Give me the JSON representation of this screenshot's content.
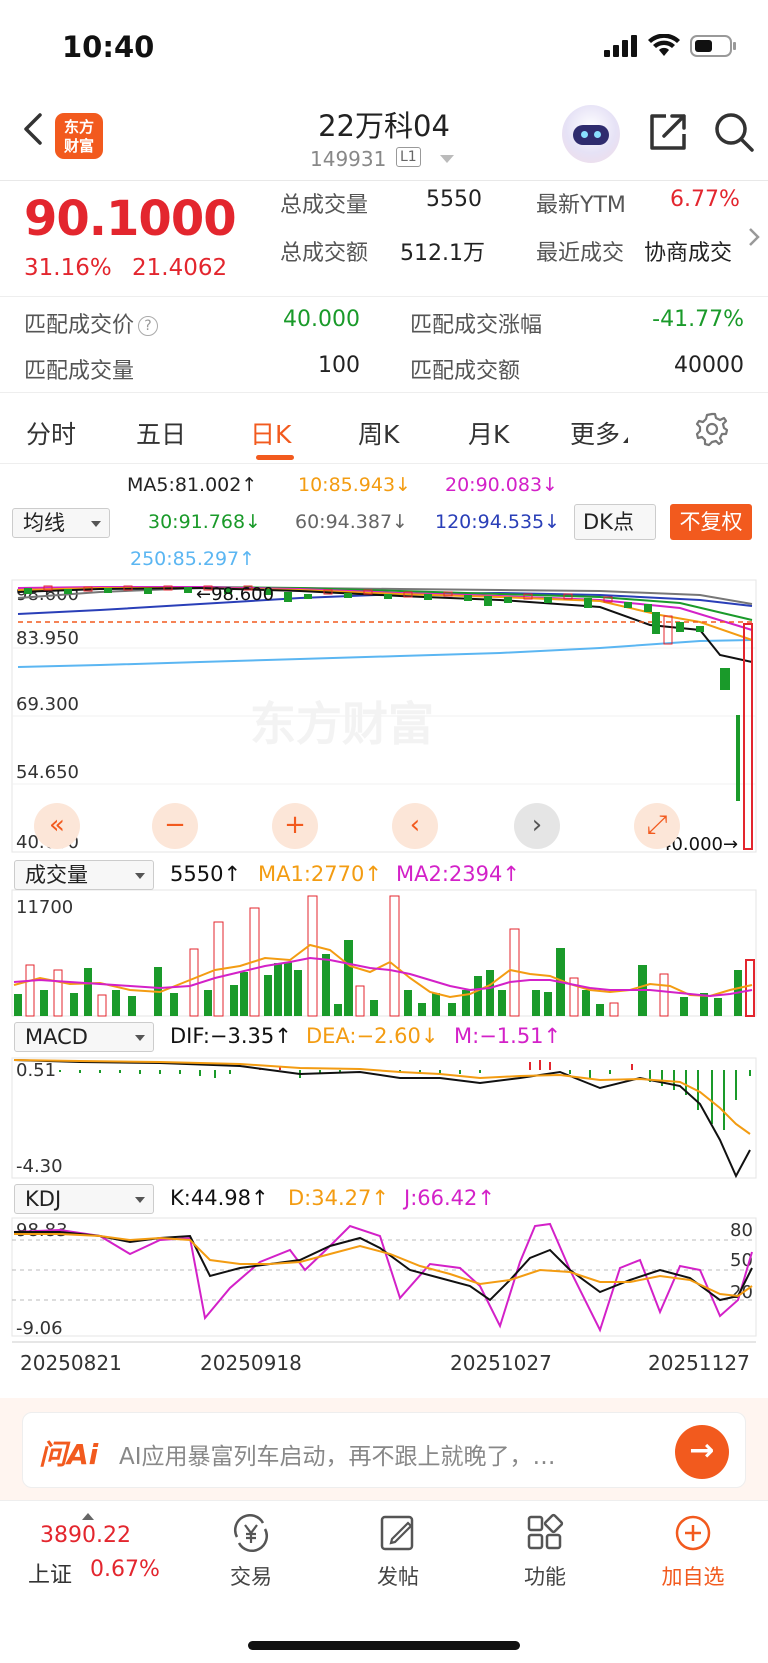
{
  "status_bar": {
    "time": "10:40"
  },
  "header": {
    "logo_line1": "东方",
    "logo_line2": "财富",
    "stock_name": "22万科04",
    "stock_code": "149931",
    "market_badge": "L1"
  },
  "quote": {
    "price": "90.1000",
    "change_pct": "31.16%",
    "change_amt": "21.4062",
    "total_volume_label": "总成交量",
    "total_volume": "5550",
    "total_amount_label": "总成交额",
    "total_amount": "512.1万",
    "ytm_label": "最新YTM",
    "ytm": "6.77%",
    "recent_trade_label": "最近成交",
    "recent_trade": "协商成交"
  },
  "match": {
    "price_label": "匹配成交价",
    "price": "40.000",
    "change_label": "匹配成交涨幅",
    "change": "-41.77%",
    "volume_label": "匹配成交量",
    "volume": "100",
    "amount_label": "匹配成交额",
    "amount": "40000"
  },
  "tabs": [
    "分时",
    "五日",
    "日K",
    "周K",
    "月K",
    "更多"
  ],
  "active_tab": "日K",
  "ma": {
    "selector": "均线",
    "ma5": "MA5:81.002↑",
    "ma10": "10:85.943↓",
    "ma20": "20:90.083↓",
    "ma30": "30:91.768↓",
    "ma60": "60:94.387↓",
    "ma120": "120:94.535↓",
    "ma250": "250:85.297↑",
    "dk_label": "DK点",
    "fuquan_label": "不复权"
  },
  "price_chart": {
    "y_labels": [
      "98.600",
      "83.950",
      "69.300",
      "54.650",
      "40.000"
    ],
    "max_marker": "98.600",
    "last_marker": "40.000",
    "watermark": "东方财富"
  },
  "volume_panel": {
    "selector": "成交量",
    "value": "5550↑",
    "ma1": "MA1:2770↑",
    "ma2": "MA2:2394↑",
    "y_max": "11700"
  },
  "macd_panel": {
    "selector": "MACD",
    "dif": "DIF:−3.35↑",
    "dea": "DEA:−2.60↓",
    "m": "M:−1.51↑",
    "y_max": "0.51",
    "y_min": "-4.30"
  },
  "kdj_panel": {
    "selector": "KDJ",
    "k": "K:44.98↑",
    "d": "D:34.27↑",
    "j": "J:66.42↑",
    "y_max": "98.83",
    "y_min": "-9.06",
    "levels": [
      "80",
      "50",
      "20"
    ]
  },
  "x_dates": [
    "20250821",
    "20250918",
    "20251027",
    "20251127"
  ],
  "ai": {
    "logo": "问Ai",
    "text": "AI应用暴富列车启动，再不跟上就晚了，…"
  },
  "bottom_nav": {
    "index_value": "3890.22",
    "index_name": "上证",
    "index_pct": "0.67%",
    "items": [
      "交易",
      "发帖",
      "功能",
      "加自选"
    ]
  },
  "colors": {
    "up": "#e3262e",
    "down": "#1a9a2a",
    "accent": "#f25a1e"
  }
}
